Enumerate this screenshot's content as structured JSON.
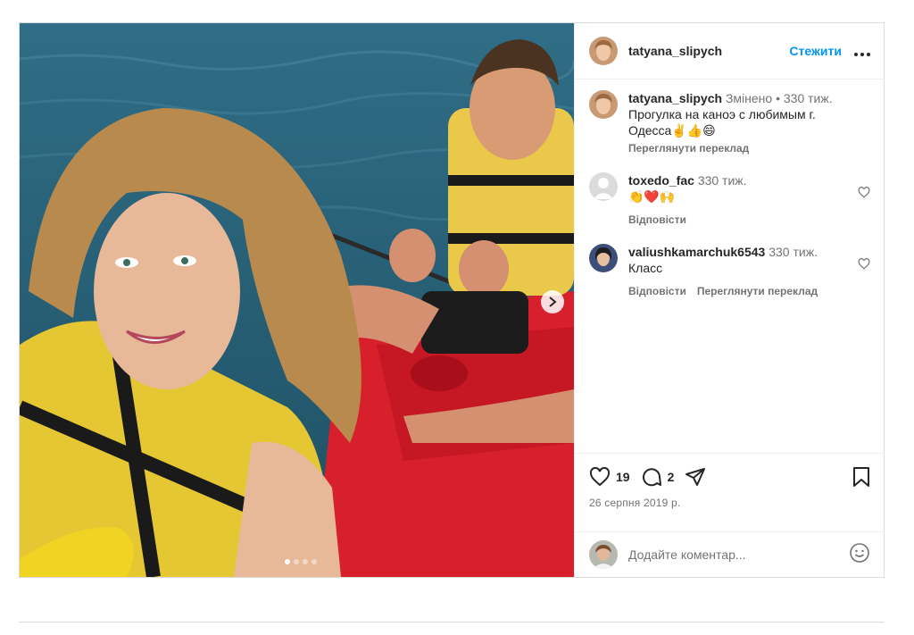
{
  "post": {
    "author": "tatyana_slipych",
    "follow_label": "Стежити",
    "more_label": "···",
    "carousel": {
      "slide_count": 4,
      "active_index": 0
    }
  },
  "caption": {
    "user": "tatyana_slipych",
    "edited": "Змінено •",
    "age": "330 тиж.",
    "text": "Прогулка на каноэ с любимым г. Одесса✌️👍😄",
    "see_translation": "Переглянути переклад"
  },
  "comments": [
    {
      "user": "toxedo_fac",
      "age": "330 тиж.",
      "text": "👏❤️🙌",
      "reply_label": "Відповісти",
      "translation_label": ""
    },
    {
      "user": "valiushkamarchuk6543",
      "age": "330 тиж.",
      "text": "Класс",
      "reply_label": "Відповісти",
      "translation_label": "Переглянути переклад"
    }
  ],
  "stats": {
    "likes": "19",
    "comments": "2",
    "date": "26 серпня 2019 р."
  },
  "add_comment": {
    "placeholder": "Додайте коментар..."
  },
  "icons": {
    "like": "heart-icon",
    "comment": "comment-bubble-icon",
    "share": "paper-plane-icon",
    "save": "bookmark-icon",
    "emoji": "smiley-icon",
    "next": "chevron-right-icon",
    "more": "more-dots-icon"
  },
  "colors": {
    "accent": "#0095f6",
    "secondary_text": "#737373",
    "border": "#dbdbdb"
  }
}
